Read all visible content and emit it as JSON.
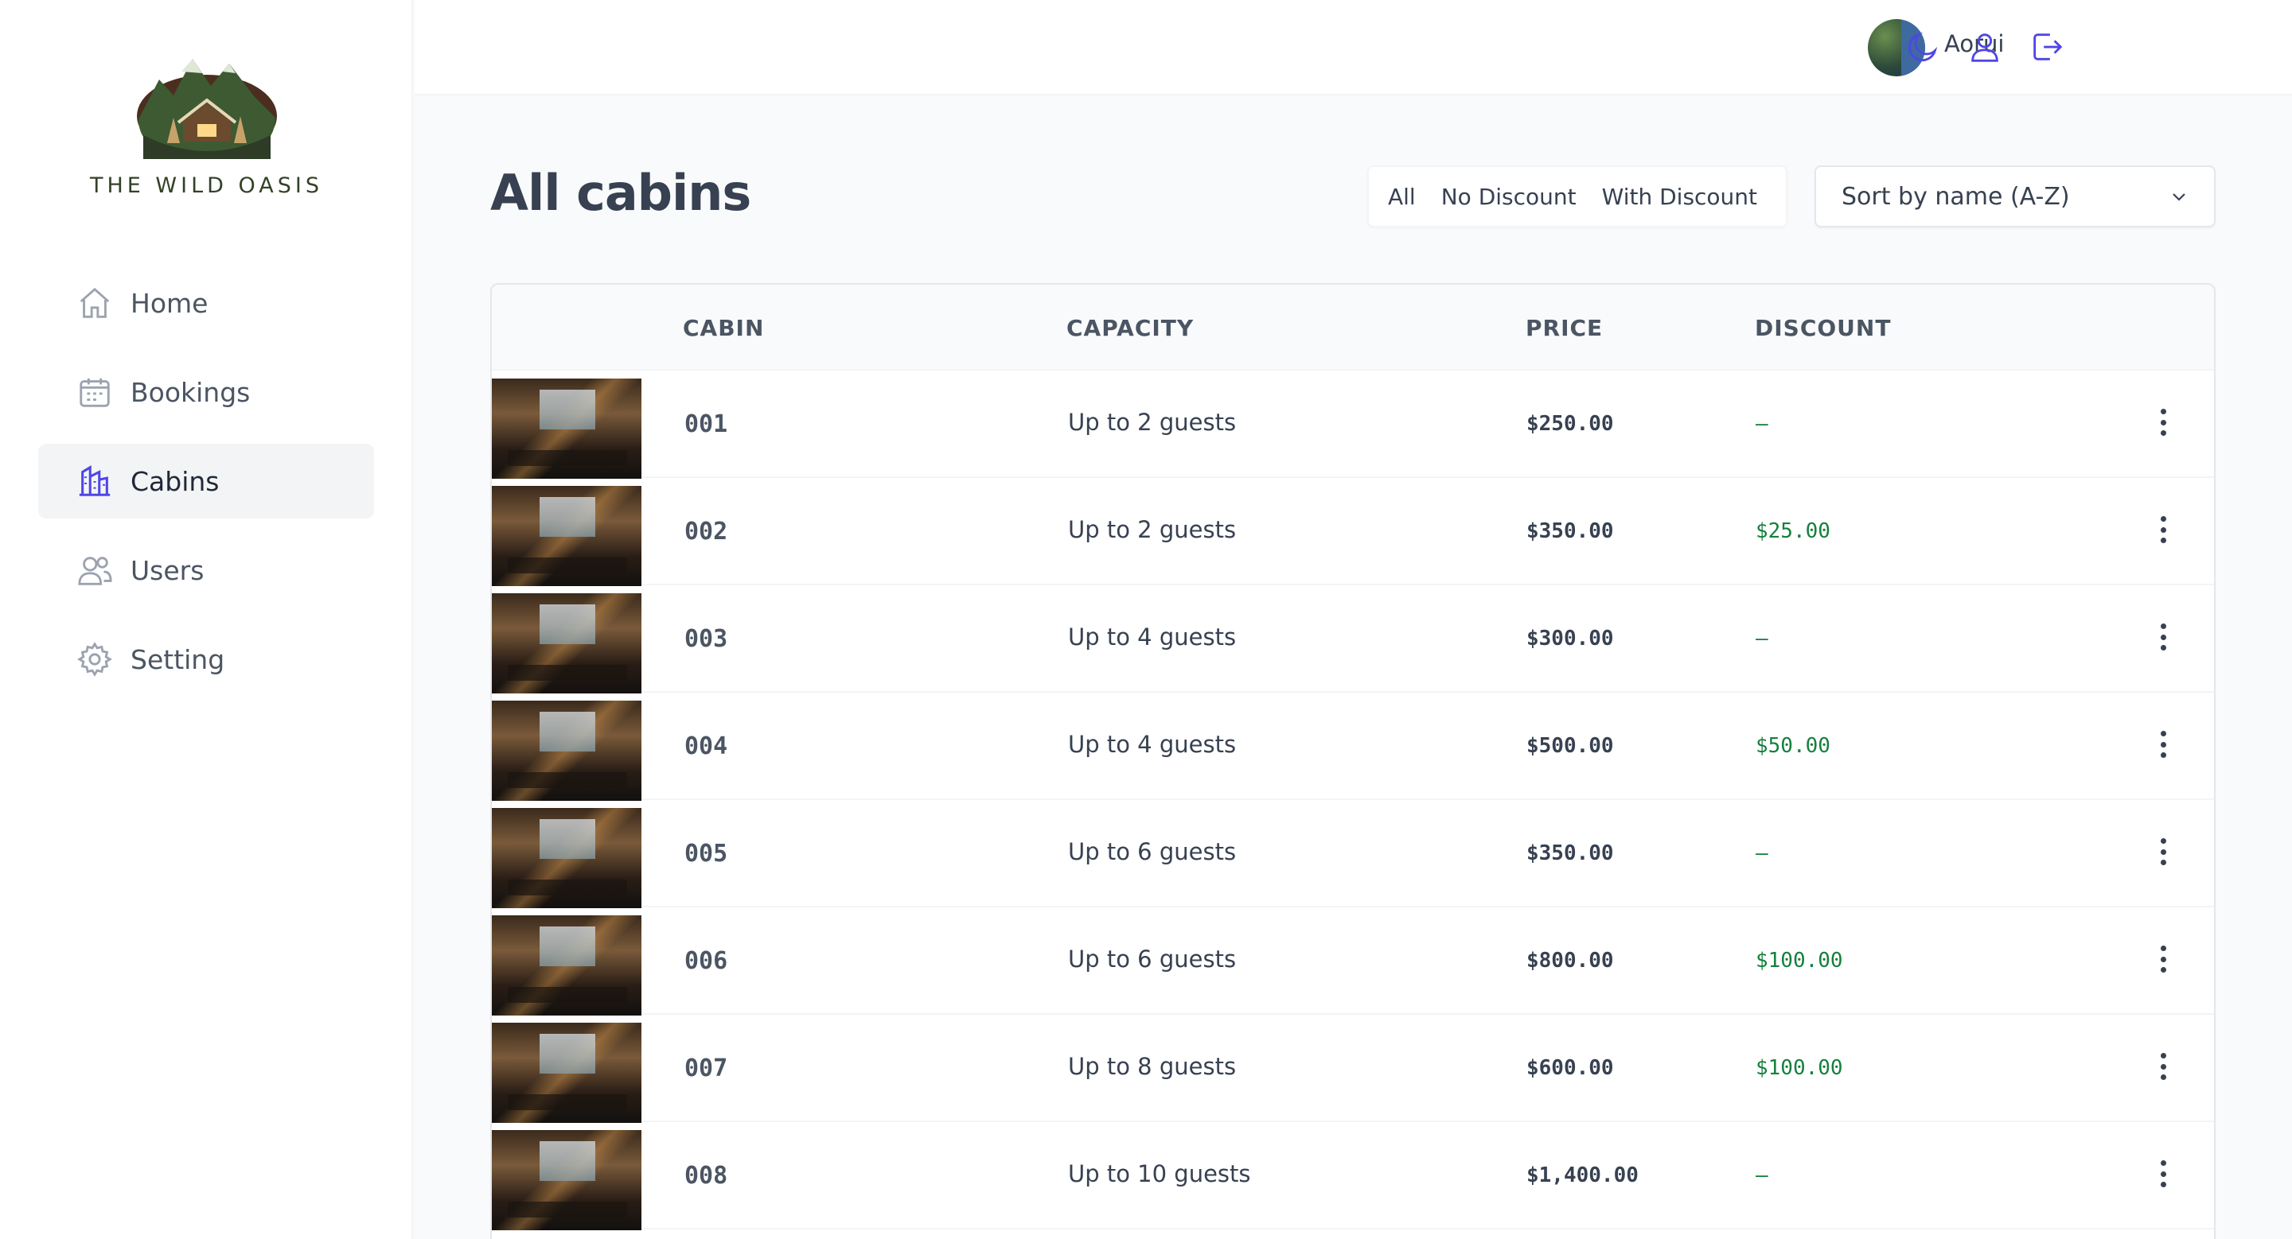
{
  "brand": {
    "name": "THE WILD OASIS"
  },
  "sidebar": {
    "items": [
      {
        "label": "Home",
        "icon": "home-icon",
        "active": false
      },
      {
        "label": "Bookings",
        "icon": "calendar-icon",
        "active": false
      },
      {
        "label": "Cabins",
        "icon": "building-icon",
        "active": true
      },
      {
        "label": "Users",
        "icon": "users-icon",
        "active": false
      },
      {
        "label": "Setting",
        "icon": "gear-icon",
        "active": false
      }
    ]
  },
  "header": {
    "user_name": "Aorui",
    "icons": [
      "moon-icon",
      "user-icon",
      "logout-icon"
    ]
  },
  "main": {
    "title": "All cabins",
    "filter": {
      "options": [
        "All",
        "No Discount",
        "With Discount"
      ]
    },
    "sort": {
      "selected": "Sort by name (A-Z)"
    }
  },
  "table": {
    "columns": [
      "CABIN",
      "CAPACITY",
      "PRICE",
      "DISCOUNT"
    ],
    "rows": [
      {
        "name": "001",
        "capacity": "Up to 2 guests",
        "price": "$250.00",
        "discount": "—"
      },
      {
        "name": "002",
        "capacity": "Up to 2 guests",
        "price": "$350.00",
        "discount": "$25.00"
      },
      {
        "name": "003",
        "capacity": "Up to 4 guests",
        "price": "$300.00",
        "discount": "—"
      },
      {
        "name": "004",
        "capacity": "Up to 4 guests",
        "price": "$500.00",
        "discount": "$50.00"
      },
      {
        "name": "005",
        "capacity": "Up to 6 guests",
        "price": "$350.00",
        "discount": "—"
      },
      {
        "name": "006",
        "capacity": "Up to 6 guests",
        "price": "$800.00",
        "discount": "$100.00"
      },
      {
        "name": "007",
        "capacity": "Up to 8 guests",
        "price": "$600.00",
        "discount": "$100.00"
      },
      {
        "name": "008",
        "capacity": "Up to 10 guests",
        "price": "$1,400.00",
        "discount": "—"
      }
    ]
  },
  "colors": {
    "accent": "#4f46e5",
    "discount_green": "#15803d",
    "brand_green": "#334226"
  }
}
